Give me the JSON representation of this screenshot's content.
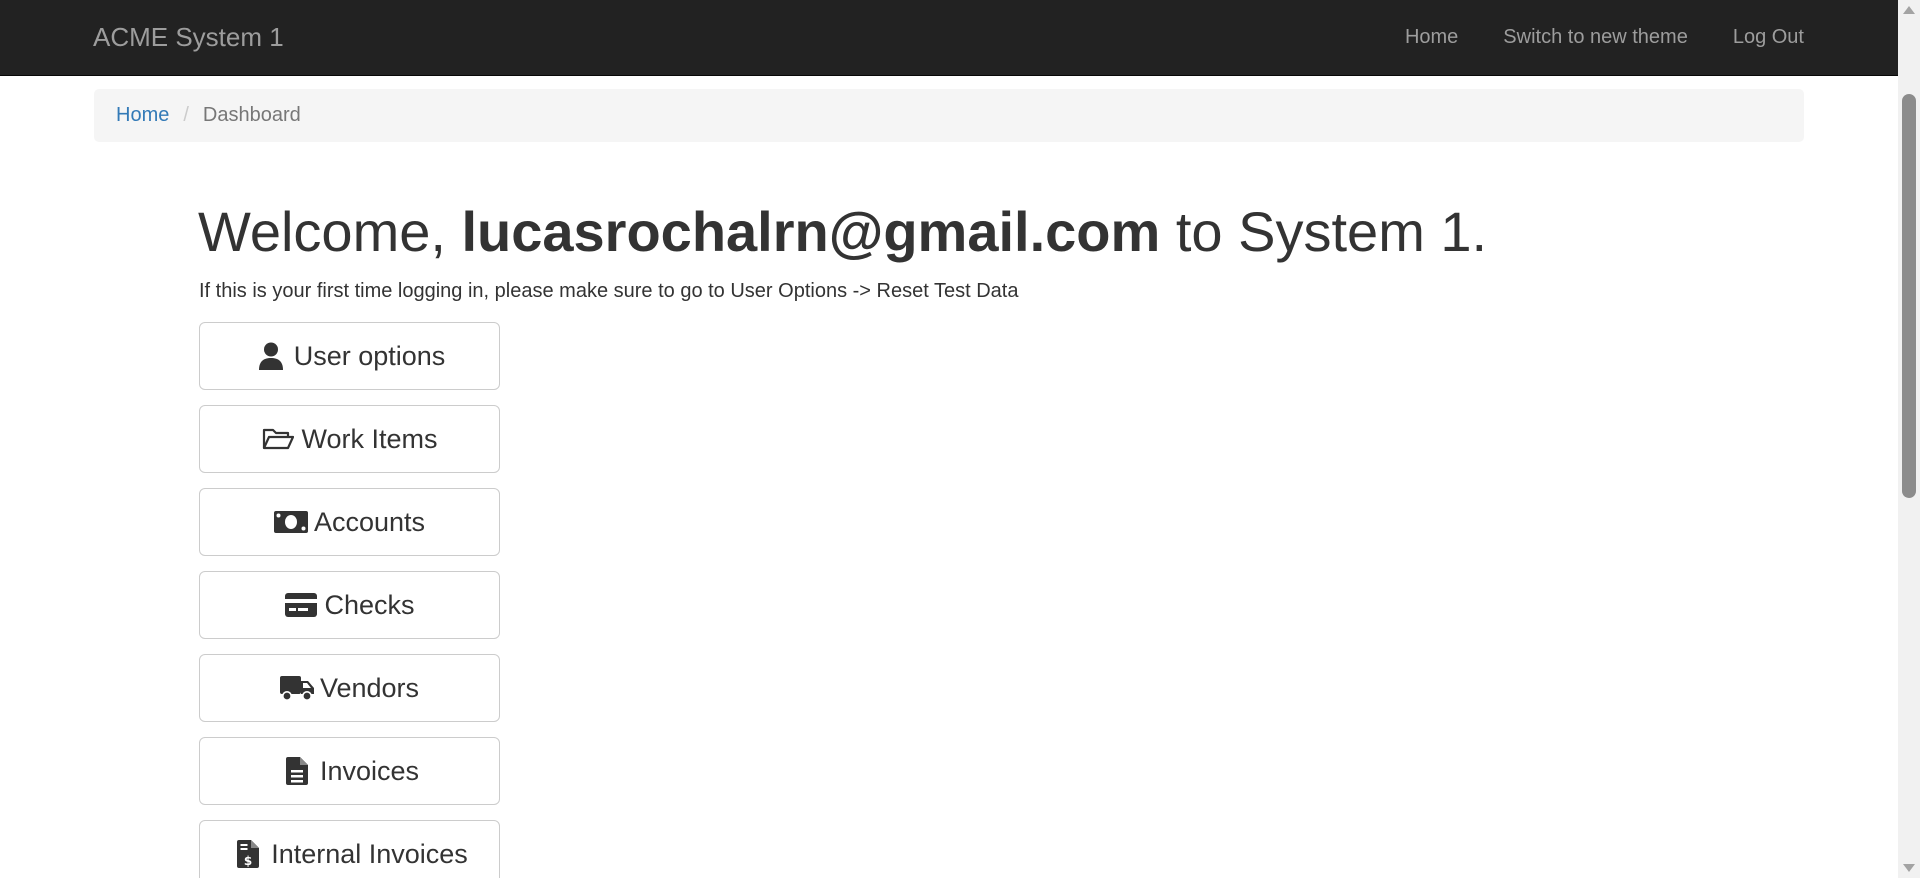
{
  "navbar": {
    "brand": "ACME System 1",
    "links": [
      {
        "label": "Home"
      },
      {
        "label": "Switch to new theme"
      },
      {
        "label": "Log Out"
      }
    ]
  },
  "breadcrumb": {
    "home": "Home",
    "separator": "/",
    "current": "Dashboard"
  },
  "main": {
    "welcome_prefix": "Welcome, ",
    "user_email": "lucasrochalrn@gmail.com",
    "welcome_suffix": " to System 1.",
    "info_text": "If this is your first time logging in, please make sure to go to User Options -> Reset Test Data",
    "buttons": [
      {
        "label": "User options",
        "icon": "user-icon"
      },
      {
        "label": "Work Items",
        "icon": "folder-open-icon"
      },
      {
        "label": "Accounts",
        "icon": "money-bill-icon"
      },
      {
        "label": "Checks",
        "icon": "credit-card-icon"
      },
      {
        "label": "Vendors",
        "icon": "truck-icon"
      },
      {
        "label": "Invoices",
        "icon": "file-text-icon"
      },
      {
        "label": "Internal Invoices",
        "icon": "file-invoice-dollar-icon"
      }
    ]
  },
  "colors": {
    "navbar_bg": "#222222",
    "navbar_text": "#9d9d9d",
    "link": "#337ab7",
    "breadcrumb_bg": "#f5f5f5",
    "text": "#333333"
  }
}
